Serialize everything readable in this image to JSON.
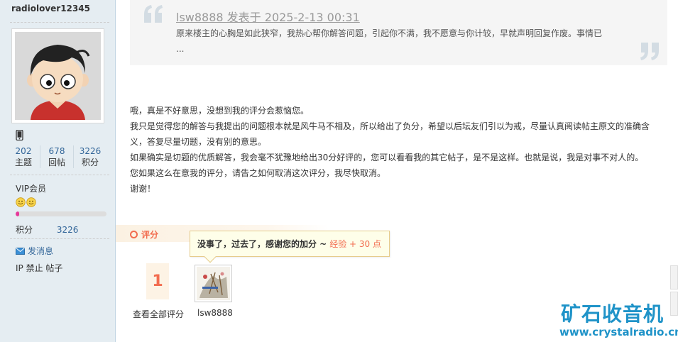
{
  "profile": {
    "username": "radiolover12345",
    "stats": [
      {
        "value": "202",
        "label": "主题"
      },
      {
        "value": "678",
        "label": "回帖"
      },
      {
        "value": "3226",
        "label": "积分"
      }
    ],
    "group": "VIP会员",
    "level_progress": 0.04,
    "points_label": "积分",
    "points_value": "3226",
    "send_message": "发消息",
    "ip_ban": "IP 禁止 帖子"
  },
  "quote": {
    "header": "lsw8888 发表于 2025-2-13 00:31",
    "text": "原来楼主的心胸是如此狭窄，我热心帮你解答问题，引起你不满，我不愿意与你计较，早就声明回复作废。事情已 ..."
  },
  "post": {
    "paragraphs": [
      "哦，真是不好意思，没想到我的评分会惹恼您。",
      "我只是觉得您的解答与我提出的问题根本就是风牛马不相及，所以给出了负分，希望以后坛友们引以为戒，尽量认真阅读帖主原文的准确含义，答复尽量切题，没有别的意思。",
      "如果确实是切题的优质解答，我会毫不犹豫地给出30分好评的，您可以看看我的其它帖子，是不是这样。也就是说，我是对事不对人的。",
      "您如果这么在意我的评分，请告之如何取消这次评分，我尽快取消。",
      "谢谢！"
    ]
  },
  "rating": {
    "title": "评分",
    "count": "1",
    "view_all": "查看全部评分",
    "tooltip_text": "没事了，过去了，感谢您的加分 ~",
    "tooltip_points": "经验 + 30 点",
    "rater_name": "lsw8888"
  },
  "watermark": {
    "name": "矿石收音机",
    "url": "www.crystalradio.cn"
  },
  "colors": {
    "accent": "#f26c4f",
    "link": "#336699",
    "sidebar_bg": "#e5edf2",
    "watermark": "#1f93c8"
  }
}
